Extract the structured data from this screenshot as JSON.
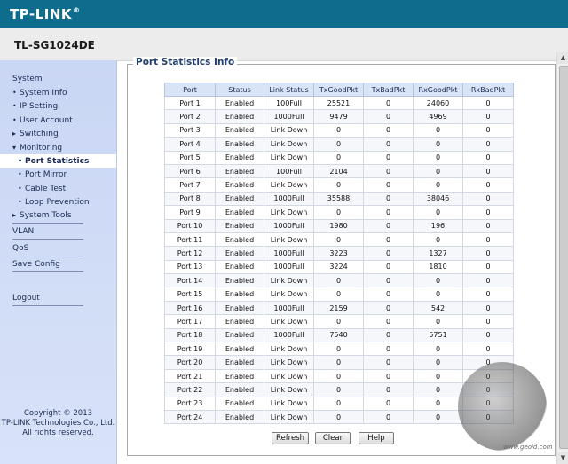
{
  "header": {
    "brand": "TP-LINK",
    "brand_mark": "®",
    "model": "TL-SG1024DE"
  },
  "sidebar": {
    "system": "System",
    "system_items": [
      "System Info",
      "IP Setting",
      "User Account",
      "Switching",
      "Monitoring"
    ],
    "monitoring_items": [
      "Port Statistics",
      "Port Mirror",
      "Cable Test",
      "Loop Prevention"
    ],
    "system_tools": "System Tools",
    "vlan": "VLAN",
    "qos": "QoS",
    "save_config": "Save Config",
    "logout": "Logout",
    "copyright": [
      "Copyright © 2013",
      "TP-LINK Technologies Co., Ltd.",
      "All rights reserved."
    ]
  },
  "main": {
    "section_title": "Port Statistics Info",
    "columns": [
      "Port",
      "Status",
      "Link Status",
      "TxGoodPkt",
      "TxBadPkt",
      "RxGoodPkt",
      "RxBadPkt"
    ],
    "rows": [
      [
        "Port 1",
        "Enabled",
        "100Full",
        "25521",
        "0",
        "24060",
        "0"
      ],
      [
        "Port 2",
        "Enabled",
        "1000Full",
        "9479",
        "0",
        "4969",
        "0"
      ],
      [
        "Port 3",
        "Enabled",
        "Link Down",
        "0",
        "0",
        "0",
        "0"
      ],
      [
        "Port 4",
        "Enabled",
        "Link Down",
        "0",
        "0",
        "0",
        "0"
      ],
      [
        "Port 5",
        "Enabled",
        "Link Down",
        "0",
        "0",
        "0",
        "0"
      ],
      [
        "Port 6",
        "Enabled",
        "100Full",
        "2104",
        "0",
        "0",
        "0"
      ],
      [
        "Port 7",
        "Enabled",
        "Link Down",
        "0",
        "0",
        "0",
        "0"
      ],
      [
        "Port 8",
        "Enabled",
        "1000Full",
        "35588",
        "0",
        "38046",
        "0"
      ],
      [
        "Port 9",
        "Enabled",
        "Link Down",
        "0",
        "0",
        "0",
        "0"
      ],
      [
        "Port 10",
        "Enabled",
        "1000Full",
        "1980",
        "0",
        "196",
        "0"
      ],
      [
        "Port 11",
        "Enabled",
        "Link Down",
        "0",
        "0",
        "0",
        "0"
      ],
      [
        "Port 12",
        "Enabled",
        "1000Full",
        "3223",
        "0",
        "1327",
        "0"
      ],
      [
        "Port 13",
        "Enabled",
        "1000Full",
        "3224",
        "0",
        "1810",
        "0"
      ],
      [
        "Port 14",
        "Enabled",
        "Link Down",
        "0",
        "0",
        "0",
        "0"
      ],
      [
        "Port 15",
        "Enabled",
        "Link Down",
        "0",
        "0",
        "0",
        "0"
      ],
      [
        "Port 16",
        "Enabled",
        "1000Full",
        "2159",
        "0",
        "542",
        "0"
      ],
      [
        "Port 17",
        "Enabled",
        "Link Down",
        "0",
        "0",
        "0",
        "0"
      ],
      [
        "Port 18",
        "Enabled",
        "1000Full",
        "7540",
        "0",
        "5751",
        "0"
      ],
      [
        "Port 19",
        "Enabled",
        "Link Down",
        "0",
        "0",
        "0",
        "0"
      ],
      [
        "Port 20",
        "Enabled",
        "Link Down",
        "0",
        "0",
        "0",
        "0"
      ],
      [
        "Port 21",
        "Enabled",
        "Link Down",
        "0",
        "0",
        "0",
        "0"
      ],
      [
        "Port 22",
        "Enabled",
        "Link Down",
        "0",
        "0",
        "0",
        "0"
      ],
      [
        "Port 23",
        "Enabled",
        "Link Down",
        "0",
        "0",
        "0",
        "0"
      ],
      [
        "Port 24",
        "Enabled",
        "Link Down",
        "0",
        "0",
        "0",
        "0"
      ]
    ],
    "buttons": {
      "refresh": "Refresh",
      "clear": "Clear",
      "help": "Help"
    }
  },
  "watermark": {
    "text": "www.geoid.com"
  },
  "colors": {
    "header": "#0e6d8c",
    "sidebar": "#c9d6f4",
    "table_header": "#d9e4f6"
  }
}
